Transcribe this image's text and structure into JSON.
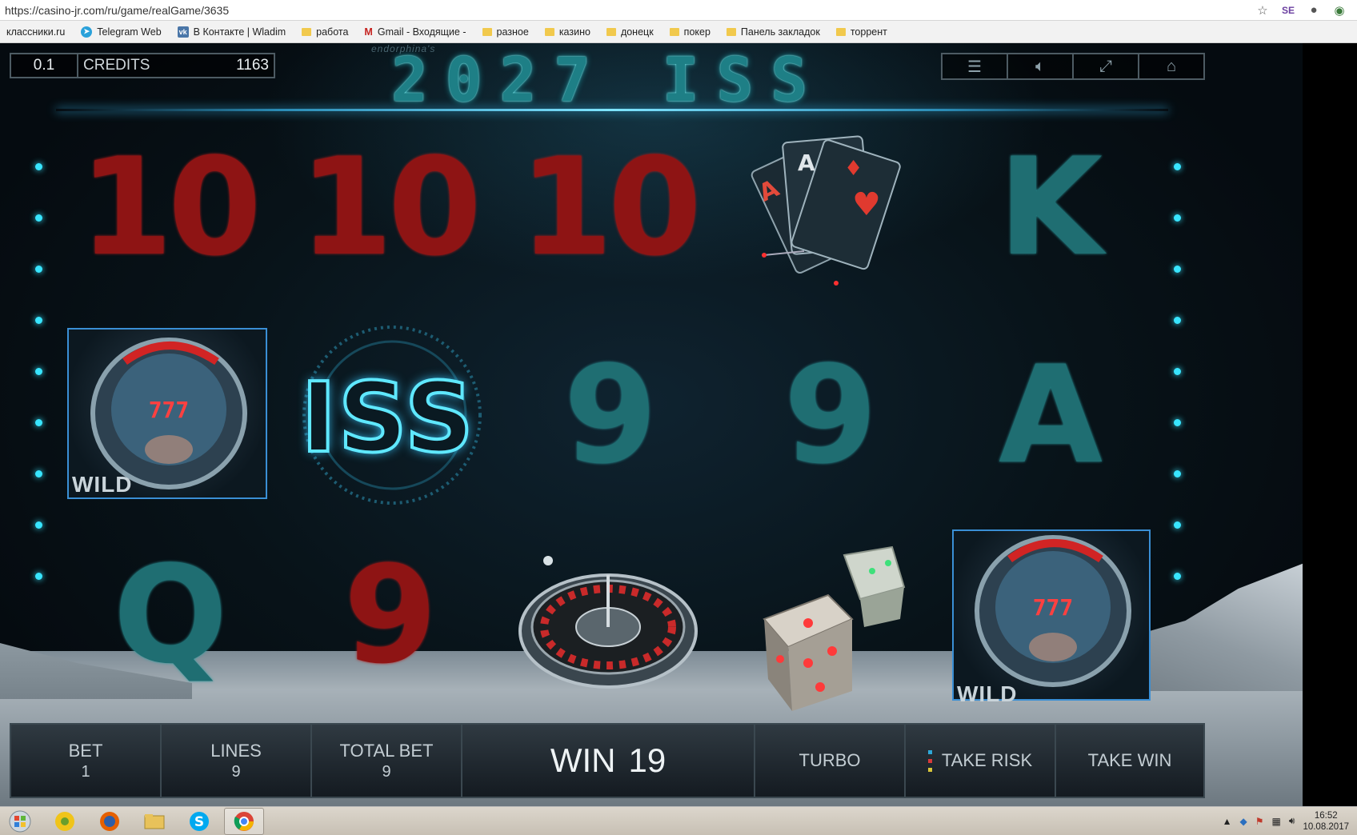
{
  "browser": {
    "url": "https://casino-jr.com/ru/game/realGame/3635",
    "bookmarks": [
      {
        "label": "классники.ru"
      },
      {
        "label": "Telegram Web"
      },
      {
        "label": "В Контакте | Wladim"
      },
      {
        "label": "работа"
      },
      {
        "label": "Gmail - Входящие -"
      },
      {
        "label": "разное"
      },
      {
        "label": "казино"
      },
      {
        "label": "донецк"
      },
      {
        "label": "покер"
      },
      {
        "label": "Панель закладок"
      },
      {
        "label": "торрент"
      }
    ]
  },
  "game": {
    "brand": "endorphina's",
    "title": "2027 ISS",
    "bet_value": "0.1",
    "credits_label": "CREDITS",
    "credits_value": "1163",
    "reels": [
      [
        "10",
        "WILD",
        "Q"
      ],
      [
        "10",
        "ISS",
        "9"
      ],
      [
        "10",
        "9",
        "roulette"
      ],
      [
        "cards",
        "9",
        "dice"
      ],
      [
        "K",
        "A",
        "WILD"
      ]
    ],
    "wild_label": "WILD",
    "wild_label_cut": "WILD",
    "bottom": {
      "bet_label": "BET",
      "bet_value": "1",
      "lines_label": "LINES",
      "lines_value": "9",
      "total_bet_label": "TOTAL BET",
      "total_bet_value": "9",
      "win_label": "WIN",
      "win_value": "19",
      "turbo_label": "TURBO",
      "take_risk_label": "TAKE RISK",
      "take_win_label": "TAKE WIN"
    }
  },
  "taskbar": {
    "time": "16:52",
    "date": "10.08.2017"
  },
  "colors": {
    "accent_cyan": "#38e5ff",
    "symbol_red": "#8e1414",
    "symbol_teal": "#1f6e72"
  }
}
